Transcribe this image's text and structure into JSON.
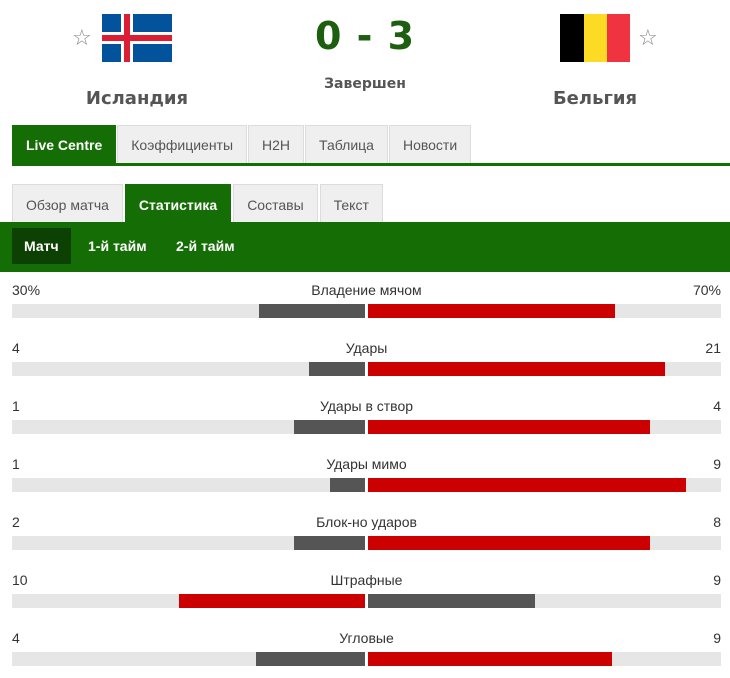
{
  "match": {
    "home": {
      "name": "Исландия",
      "star": "☆"
    },
    "away": {
      "name": "Бельгия",
      "star": "☆"
    },
    "score": "0 - 3",
    "status": "Завершен"
  },
  "main_tabs": [
    "Live Centre",
    "Коэффициенты",
    "H2H",
    "Таблица",
    "Новости"
  ],
  "sub_tabs": [
    "Обзор матча",
    "Статистика",
    "Составы",
    "Текст"
  ],
  "periods": [
    "Матч",
    "1-й тайм",
    "2-й тайм"
  ],
  "colors": {
    "accent_green": "#156d06",
    "winner_bar": "#cc0000",
    "loser_bar": "#555555",
    "track": "#e6e6e6"
  },
  "stats": [
    {
      "label": "Владение мячом",
      "home": "30%",
      "away": "70%",
      "home_val": 30,
      "away_val": 70
    },
    {
      "label": "Удары",
      "home": "4",
      "away": "21",
      "home_val": 4,
      "away_val": 21
    },
    {
      "label": "Удары в створ",
      "home": "1",
      "away": "4",
      "home_val": 1,
      "away_val": 4
    },
    {
      "label": "Удары мимо",
      "home": "1",
      "away": "9",
      "home_val": 1,
      "away_val": 9
    },
    {
      "label": "Блок-но ударов",
      "home": "2",
      "away": "8",
      "home_val": 2,
      "away_val": 8
    },
    {
      "label": "Штрафные",
      "home": "10",
      "away": "9",
      "home_val": 10,
      "away_val": 9
    },
    {
      "label": "Угловые",
      "home": "4",
      "away": "9",
      "home_val": 4,
      "away_val": 9
    }
  ]
}
